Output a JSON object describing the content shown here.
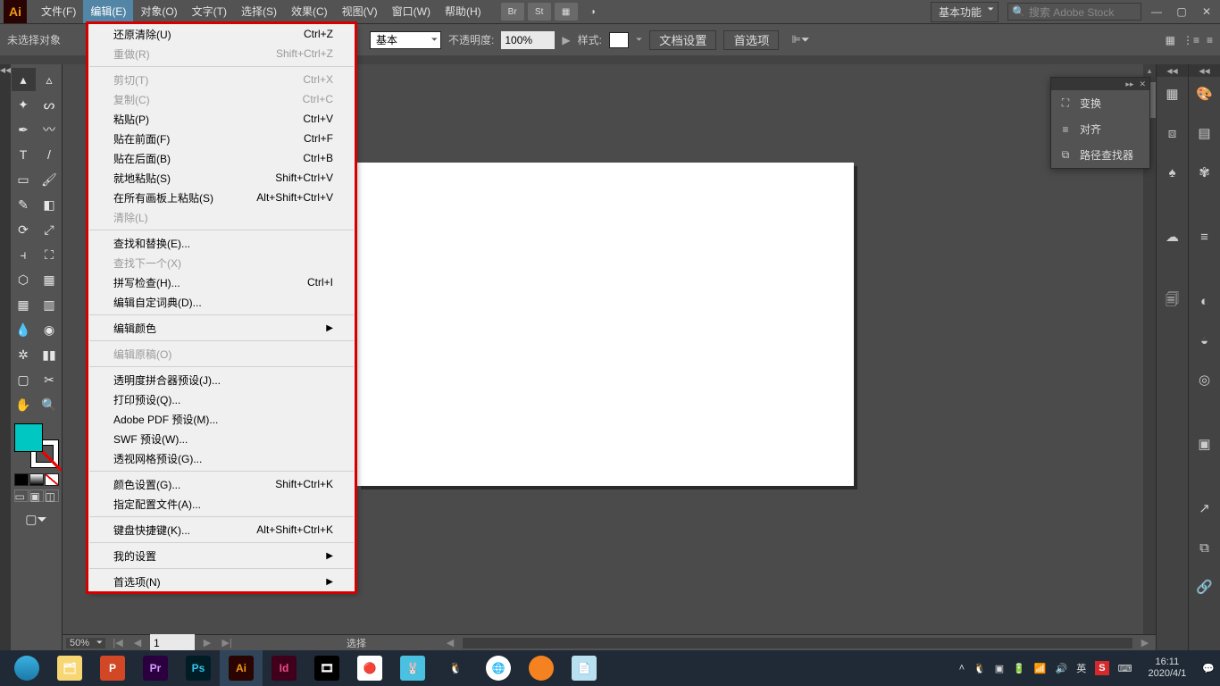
{
  "app": {
    "logo": "Ai"
  },
  "menubar": {
    "items": [
      "文件(F)",
      "编辑(E)",
      "对象(O)",
      "文字(T)",
      "选择(S)",
      "效果(C)",
      "视图(V)",
      "窗口(W)",
      "帮助(H)"
    ],
    "active_index": 1,
    "bridge": "Br",
    "stock": "St",
    "workspace": "基本功能",
    "search_placeholder": "搜索 Adobe Stock"
  },
  "controlbar": {
    "no_selection": "未选择对象",
    "style_label": "基本",
    "opacity_label": "不透明度:",
    "opacity_value": "100%",
    "pattern_label": "样式:",
    "doc_setup": "文档设置",
    "prefs": "首选项"
  },
  "edit_menu": {
    "items": [
      {
        "label": "还原清除(U)",
        "shortcut": "Ctrl+Z"
      },
      {
        "label": "重做(R)",
        "shortcut": "Shift+Ctrl+Z",
        "disabled": true
      },
      {
        "sep": true
      },
      {
        "label": "剪切(T)",
        "shortcut": "Ctrl+X",
        "disabled": true
      },
      {
        "label": "复制(C)",
        "shortcut": "Ctrl+C",
        "disabled": true
      },
      {
        "label": "粘贴(P)",
        "shortcut": "Ctrl+V"
      },
      {
        "label": "贴在前面(F)",
        "shortcut": "Ctrl+F"
      },
      {
        "label": "贴在后面(B)",
        "shortcut": "Ctrl+B"
      },
      {
        "label": "就地粘贴(S)",
        "shortcut": "Shift+Ctrl+V"
      },
      {
        "label": "在所有画板上粘贴(S)",
        "shortcut": "Alt+Shift+Ctrl+V"
      },
      {
        "label": "清除(L)",
        "disabled": true
      },
      {
        "sep": true
      },
      {
        "label": "查找和替换(E)..."
      },
      {
        "label": "查找下一个(X)",
        "disabled": true
      },
      {
        "label": "拼写检查(H)...",
        "shortcut": "Ctrl+I"
      },
      {
        "label": "编辑自定词典(D)..."
      },
      {
        "sep": true
      },
      {
        "label": "编辑颜色",
        "sub": true
      },
      {
        "sep": true
      },
      {
        "label": "编辑原稿(O)",
        "disabled": true
      },
      {
        "sep": true
      },
      {
        "label": "透明度拼合器预设(J)..."
      },
      {
        "label": "打印预设(Q)..."
      },
      {
        "label": "Adobe PDF 预设(M)..."
      },
      {
        "label": "SWF 预设(W)..."
      },
      {
        "label": "透视网格预设(G)..."
      },
      {
        "sep": true
      },
      {
        "label": "颜色设置(G)...",
        "shortcut": "Shift+Ctrl+K"
      },
      {
        "label": "指定配置文件(A)..."
      },
      {
        "sep": true
      },
      {
        "label": "键盘快捷键(K)...",
        "shortcut": "Alt+Shift+Ctrl+K"
      },
      {
        "sep": true
      },
      {
        "label": "我的设置",
        "sub": true
      },
      {
        "sep": true
      },
      {
        "label": "首选项(N)",
        "sub": true
      }
    ]
  },
  "float_panel": {
    "rows": [
      {
        "icon": "⛶",
        "label": "变换"
      },
      {
        "icon": "≡",
        "label": "对齐"
      },
      {
        "icon": "⧉",
        "label": "路径查找器"
      }
    ]
  },
  "canvas_status": {
    "zoom": "50%",
    "page": "1",
    "mode": "选择"
  },
  "taskbar": {
    "ime": "英",
    "time": "16:11",
    "date": "2020/4/1"
  }
}
